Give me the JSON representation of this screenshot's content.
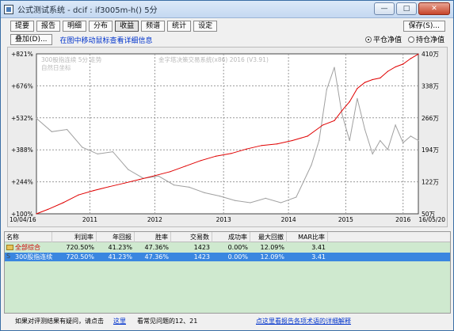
{
  "window": {
    "title": "公式测试系统 - dcif : if3005m-h() 5分"
  },
  "window_buttons": {
    "min": "—",
    "max": "□",
    "close": "✕"
  },
  "toolbar": {
    "tabs": [
      "提要",
      "报告",
      "明细",
      "分布",
      "收益",
      "频谱",
      "统计",
      "设定"
    ],
    "active": "收益",
    "save": "保存(S)..."
  },
  "row2": {
    "overlay": "叠加(D)...",
    "hint": "在图中移动鼠标查看详细信息",
    "radio1": "平仓净值",
    "radio2": "持仓净值"
  },
  "chart_data": {
    "type": "line",
    "legend_left": "300股指连续 5分 走势",
    "legend_left2": "自然日坐标",
    "legend_center": "金字塔决策交易系统(x86) 2016 (V3.91)",
    "x_ticks": [
      "10/04/16",
      "2011",
      "2012",
      "2013",
      "2014",
      "2015",
      "2016",
      "16/05/20"
    ],
    "y_left_ticks": [
      "+100%",
      "+244%",
      "+388%",
      "+532%",
      "+676%",
      "+821%"
    ],
    "y_right_ticks": [
      "50万",
      "122万",
      "194万",
      "266万",
      "338万",
      "410万"
    ],
    "y_left_range": [
      100,
      821
    ],
    "y_right_range": [
      50,
      410
    ],
    "series": [
      {
        "color": "#e00000",
        "x": [
          0,
          0.03,
          0.07,
          0.11,
          0.15,
          0.19,
          0.23,
          0.27,
          0.31,
          0.35,
          0.39,
          0.43,
          0.47,
          0.51,
          0.55,
          0.59,
          0.63,
          0.67,
          0.71,
          0.75,
          0.78,
          0.8,
          0.82,
          0.84,
          0.86,
          0.88,
          0.9,
          0.92,
          0.94,
          0.96,
          0.98,
          1.0
        ],
        "y": [
          100,
          120,
          150,
          185,
          205,
          222,
          238,
          255,
          272,
          290,
          315,
          340,
          360,
          372,
          392,
          408,
          415,
          430,
          450,
          500,
          520,
          565,
          605,
          665,
          692,
          705,
          712,
          742,
          762,
          775,
          800,
          820
        ]
      },
      {
        "color": "#a0a0a0",
        "x": [
          0,
          0.04,
          0.08,
          0.12,
          0.16,
          0.2,
          0.24,
          0.28,
          0.32,
          0.36,
          0.4,
          0.44,
          0.48,
          0.52,
          0.56,
          0.6,
          0.64,
          0.68,
          0.72,
          0.74,
          0.76,
          0.78,
          0.8,
          0.82,
          0.84,
          0.86,
          0.88,
          0.9,
          0.92,
          0.94,
          0.96,
          0.98,
          1.0
        ],
        "y": [
          530,
          470,
          480,
          400,
          370,
          380,
          300,
          260,
          270,
          230,
          220,
          195,
          180,
          160,
          150,
          170,
          150,
          175,
          320,
          430,
          660,
          760,
          550,
          430,
          620,
          480,
          370,
          430,
          390,
          500,
          420,
          450,
          430
        ]
      }
    ]
  },
  "table": {
    "headers": [
      "名称",
      "利润率",
      "年回报",
      "胜率",
      "交易数",
      "成功率",
      "最大回撤",
      "MAR比率"
    ],
    "rows": [
      [
        "全部综合",
        "720.50%",
        "41.23%",
        "47.36%",
        "1423",
        "0.00%",
        "12.09%",
        "3.41"
      ],
      [
        "300股指连续",
        "720.50%",
        "41.23%",
        "47.36%",
        "1423",
        "0.00%",
        "12.09%",
        "3.41"
      ]
    ],
    "row2_prefix": "S"
  },
  "status": {
    "text1": "如果对评测结果有疑问，请点击",
    "link1": "这里",
    "text2": "看常见问题的12、21",
    "link2": "点这里看报告各项术语的详细解释"
  }
}
